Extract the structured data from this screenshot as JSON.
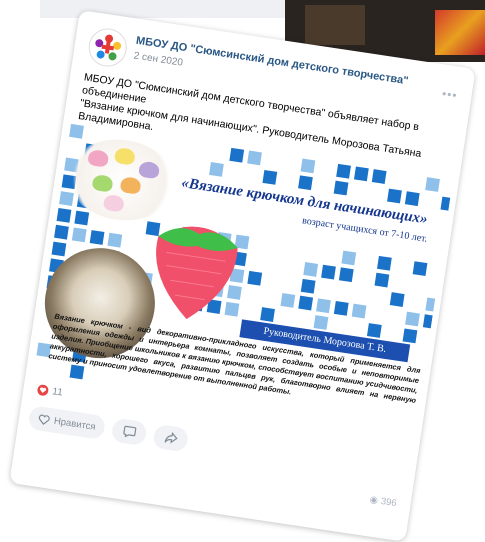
{
  "post": {
    "author": "МБОУ ДО \"Сюмсинский дом детского творчества\"",
    "date": "2 сен 2020",
    "menu_icon": "more-horizontal-icon",
    "text_line1": "МБОУ ДО \"Сюмсинский дом детского творчества\" объявляет набор в объединение",
    "text_line2": "\"Вязание крючком для начинающих\". Руководитель Морозова Татьяна",
    "text_line3": "Владимировна."
  },
  "poster": {
    "title": "«Вязание крючком для начинающих»",
    "age": "возраст учащихся от 7-10 лет.",
    "leader": "Руководитель Морозова Т. В.",
    "description": "Вязание крючком - вид декоративно-прикладного искусства, который применяется для оформления одежды и интерьера комнаты, позволяет создать особые и неповторимые изделия. Приобщение школьников к вязанию крючком, способствует воспитанию усидчивости, аккуратности, хорошего вкуса, развитию пальцев рук, благотворно влияет на нервную систему и приносит удовлетворение от выполненной работы.",
    "colors": {
      "mosaic_dark": "#1b73c9",
      "mosaic_light": "#8fc0ea",
      "title": "#14368f"
    }
  },
  "footer": {
    "likes_count": "11",
    "like_label": "Нравится",
    "views_count": "396",
    "accent": "#e64646"
  }
}
